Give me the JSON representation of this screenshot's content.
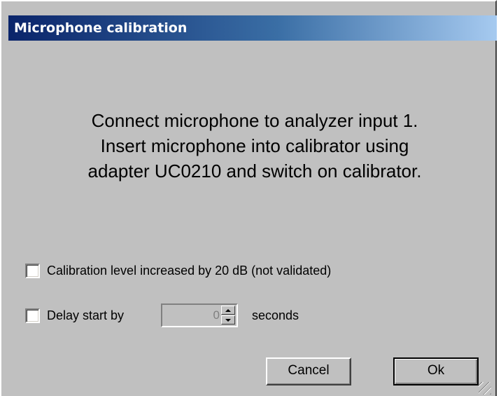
{
  "window": {
    "title": "Microphone calibration"
  },
  "message": {
    "lines": [
      "Connect microphone to analyzer input 1.",
      "Insert microphone into calibrator using",
      "adapter UC0210 and switch on calibrator."
    ]
  },
  "options": {
    "calibration_level": {
      "label": "Calibration level increased by 20 dB (not validated)",
      "checked": false
    },
    "delay_start": {
      "label": "Delay start by",
      "checked": false,
      "value": "0",
      "unit": "seconds"
    }
  },
  "buttons": {
    "cancel": "Cancel",
    "ok": "Ok"
  },
  "icons": {
    "spin_up": "arrow-up-icon",
    "spin_down": "arrow-down-icon",
    "resize": "resize-grip-icon"
  },
  "colors": {
    "titlebar_start": "#0a246a",
    "titlebar_end": "#a6caf0",
    "window_bg": "#c0c0c0"
  }
}
